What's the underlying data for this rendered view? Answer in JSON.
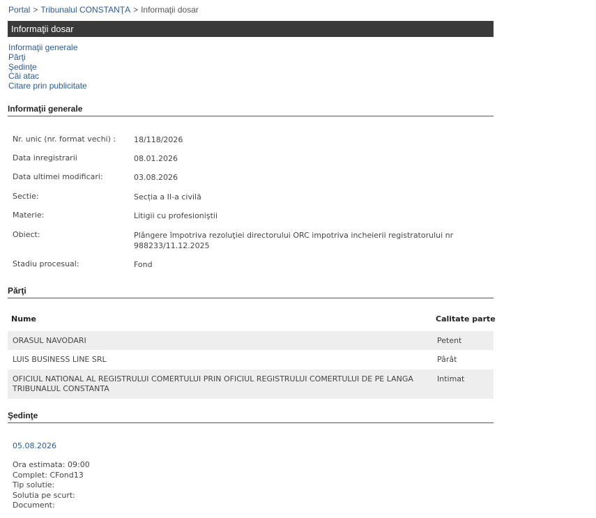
{
  "breadcrumb": {
    "portal": "Portal",
    "court": "Tribunalul CONSTANŢA",
    "current": "Informaţii dosar",
    "separator": ">"
  },
  "header": {
    "title": "Informaţii dosar"
  },
  "nav": {
    "items": [
      "Informaţii generale",
      "Părţi",
      "Şedinţe",
      "Căi atac",
      "Citare prin publicitate"
    ]
  },
  "general": {
    "title": "Informaţii generale",
    "rows": [
      {
        "label": "Nr. unic (nr. format vechi) :",
        "value": "18/118/2026"
      },
      {
        "label": "Data inregistrarii",
        "value": "08.01.2026"
      },
      {
        "label": "Data ultimei modificari:",
        "value": "03.08.2026"
      },
      {
        "label": "Sectie:",
        "value": "Secția a II-a civilă"
      },
      {
        "label": "Materie:",
        "value": "Litigii cu profesioniştii"
      },
      {
        "label": "Obiect:",
        "value": "Plângere împotriva rezoluţiei directorului ORC impotriva incheierii registratorului nr 988233/11.12.2025"
      },
      {
        "label": "Stadiu procesual:",
        "value": "Fond"
      }
    ]
  },
  "parti": {
    "title": "Părţi",
    "headers": {
      "name": "Nume",
      "role": "Calitate parte"
    },
    "rows": [
      {
        "name": "ORASUL NAVODARI",
        "role": "Petent"
      },
      {
        "name": "LUIS BUSINESS LINE SRL",
        "role": "Pârât"
      },
      {
        "name": "OFICIUL NATIONAL AL REGISTRULUI COMERTULUI PRIN OFICIUL REGISTRULUI COMERTULUI DE PE LANGA TRIBUNALUL CONSTANTA",
        "role": "Intimat"
      }
    ]
  },
  "sedinte": {
    "title": "Şedinţe",
    "date": "05.08.2026",
    "details": [
      "Ora estimata: 09:00",
      "Complet: CFond13",
      "Tip solutie:",
      "Solutia pe scurt:",
      "Document:"
    ]
  },
  "colors": {
    "link": "#2a5b9a",
    "bar": "#3a3a3a",
    "row_shade": "#eeeeee"
  }
}
